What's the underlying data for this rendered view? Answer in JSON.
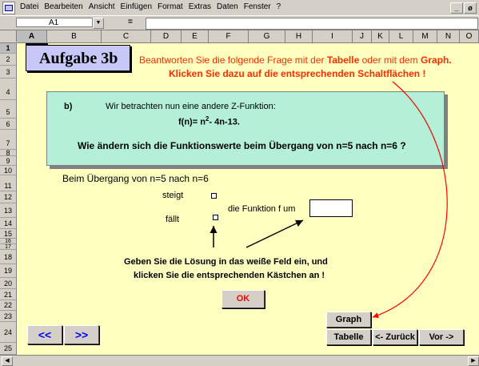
{
  "menu": {
    "items": [
      "Datei",
      "Bearbeiten",
      "Ansicht",
      "Einfügen",
      "Format",
      "Extras",
      "Daten",
      "Fenster",
      "?"
    ],
    "window_controls": [
      "_",
      "ø"
    ]
  },
  "formula_bar": {
    "name_box": "A1",
    "equals": "=",
    "content": ""
  },
  "columns": [
    "A",
    "B",
    "C",
    "D",
    "E",
    "F",
    "G",
    "H",
    "I",
    "J",
    "K",
    "L",
    "M",
    "N",
    "O"
  ],
  "rows": [
    "1",
    "2",
    "3",
    "4",
    "5",
    "6",
    "7",
    "8",
    "9",
    "10",
    "11",
    "12",
    "13",
    "14",
    "15",
    "16",
    "17",
    "18",
    "19",
    "20",
    "21",
    "22",
    "23",
    "24",
    "25"
  ],
  "title": "Aufgabe 3b",
  "instruction": {
    "line1_prefix": "Beantworten Sie die folgende Frage mit der ",
    "line1_bold1": "Tabelle",
    "line1_mid": " oder mit dem ",
    "line1_bold2": "Graph.",
    "line2": "Klicken Sie dazu auf die entsprechenden Schaltflächen !"
  },
  "question": {
    "label": "b)",
    "intro": "Wir betrachten nun eine andere Z-Funktion:",
    "function_prefix": "f(n)= n",
    "function_exp": "2",
    "function_suffix": "- 4n-13.",
    "question": "Wie ändern sich die Funktionswerte beim Übergang von n=5 nach n=6 ?"
  },
  "answer_section": {
    "transition": "Beim Übergang von n=5 nach  n=6",
    "option_rises": "steigt",
    "option_falls": "fällt",
    "function_by": "die Funktion f um",
    "answer_value": ""
  },
  "hint": {
    "line1": "Geben Sie die Lösung in das weiße Feld ein, und",
    "line2": "klicken Sie die entsprechenden Kästchen an !"
  },
  "buttons": {
    "ok": "OK",
    "graph": "Graph",
    "table": "Tabelle",
    "back": "<- Zurück",
    "forward": "Vor ->",
    "first": "<<",
    "next": ">>"
  },
  "colors": {
    "sheet_bg": "#ffffc0",
    "question_bg": "#b4f0d8",
    "title_bg": "#c8c8f8",
    "instruction": "#ff2a00",
    "nav_blue": "#0000ff"
  }
}
